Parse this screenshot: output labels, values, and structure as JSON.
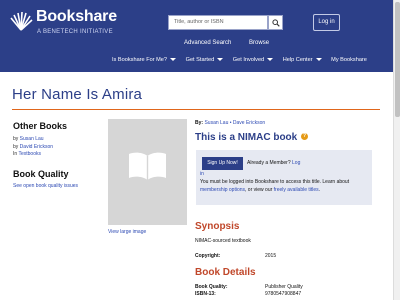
{
  "header": {
    "logo_name": "Bookshare",
    "logo_tagline": "A BENETECH INITIATIVE",
    "search_placeholder": "Title, author or ISBN",
    "login_label": "Log in",
    "top_links": [
      "Advanced Search",
      "Browse"
    ],
    "nav": [
      "Is Bookshare For Me?",
      "Get Started",
      "Get Involved",
      "Help Center",
      "My Bookshare"
    ]
  },
  "book": {
    "title": "Her Name Is Amira",
    "by_label": "By:",
    "authors": "Susan Lau • Dave Erickson",
    "view_large": "View large image"
  },
  "sidebar": {
    "other_books_heading": "Other Books",
    "by1_prefix": "by",
    "by1_link": "Susan Lau",
    "by2_prefix": "by",
    "by2_link": "David Erickson",
    "in_prefix": "In",
    "in_link": "Textbooks",
    "quality_heading": "Book Quality",
    "quality_link": "See open book quality issues"
  },
  "nimac": {
    "heading": "This is a NIMAC book",
    "help_icon": "?",
    "signup_label": "Sign Up Now!",
    "already_member": "Already a Member?",
    "login_link_1": "Log",
    "login_link_2": "in",
    "notice_1": "You must be logged into Bookshare to access this title. Learn about",
    "notice_link_1": "membership options",
    "notice_2": ", or view our",
    "notice_link_2": "freely available titles",
    "notice_3": "."
  },
  "synopsis": {
    "heading": "Synopsis",
    "text": "NIMAC-sourced textbook",
    "copyright_label": "Copyright:",
    "copyright_value": "2015"
  },
  "details": {
    "heading": "Book Details",
    "quality_label": "Book Quality:",
    "quality_value": "Publisher Quality",
    "isbn_label": "ISBN-13:",
    "isbn_value": "9780547908847"
  },
  "colors": {
    "header_bg": "#2c3f88",
    "accent_orange": "#e0661b",
    "heading_red": "#c0472a",
    "link_blue": "#2c49b3"
  }
}
